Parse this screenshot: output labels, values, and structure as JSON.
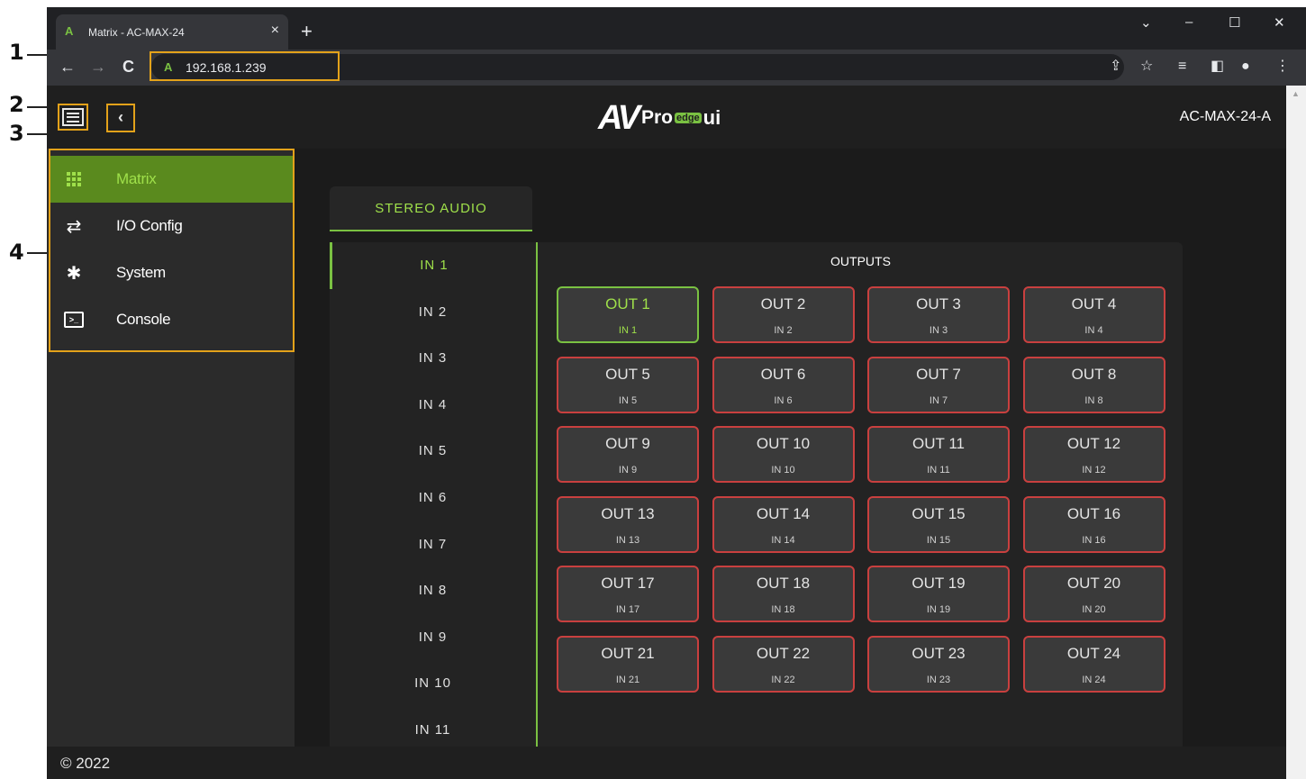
{
  "callouts": [
    "1",
    "2",
    "3",
    "4"
  ],
  "browser": {
    "tab_title": "Matrix - AC-MAX-24",
    "tab_close_glyph": "×",
    "new_tab_glyph": "+",
    "favicon_glyph": "A",
    "url": "192.168.1.239",
    "window_controls": [
      "⌄",
      "–",
      "☐",
      "✕"
    ],
    "nav": {
      "back": "←",
      "forward": "→",
      "reload": "C"
    },
    "toolbar_icons": [
      "⇪",
      "☆",
      "≡",
      "◧",
      "●",
      "⋮"
    ]
  },
  "app": {
    "logo": {
      "av": "AV",
      "pro": "Pro",
      "edge": "edge",
      "ui": "ui"
    },
    "device_name": "AC-MAX-24-A",
    "collapse_glyph": "‹",
    "nav_items": [
      {
        "label": "Matrix",
        "icon": "grid-icon",
        "active": true
      },
      {
        "label": "I/O Config",
        "icon": "swap-arrows-icon",
        "active": false
      },
      {
        "label": "System",
        "icon": "gear-icon",
        "active": false
      },
      {
        "label": "Console",
        "icon": "terminal-icon",
        "active": false
      }
    ],
    "icons": {
      "swap": "⇄",
      "gear": "✱",
      "terminal": ">_"
    },
    "footer": "© 2022"
  },
  "matrix": {
    "tab_label": "STEREO AUDIO",
    "outputs_title": "OUTPUTS",
    "inputs": [
      "IN 1",
      "IN 2",
      "IN 3",
      "IN 4",
      "IN 5",
      "IN 6",
      "IN 7",
      "IN 8",
      "IN 9",
      "IN 10",
      "IN 11"
    ],
    "selected_input": "IN 1",
    "outputs": [
      {
        "name": "OUT 1",
        "source": "IN 1"
      },
      {
        "name": "OUT 2",
        "source": "IN 2"
      },
      {
        "name": "OUT 3",
        "source": "IN 3"
      },
      {
        "name": "OUT 4",
        "source": "IN 4"
      },
      {
        "name": "OUT 5",
        "source": "IN 5"
      },
      {
        "name": "OUT 6",
        "source": "IN 6"
      },
      {
        "name": "OUT 7",
        "source": "IN 7"
      },
      {
        "name": "OUT 8",
        "source": "IN 8"
      },
      {
        "name": "OUT 9",
        "source": "IN 9"
      },
      {
        "name": "OUT 10",
        "source": "IN 10"
      },
      {
        "name": "OUT 11",
        "source": "IN 11"
      },
      {
        "name": "OUT 12",
        "source": "IN 12"
      },
      {
        "name": "OUT 13",
        "source": "IN 13"
      },
      {
        "name": "OUT 14",
        "source": "IN 14"
      },
      {
        "name": "OUT 15",
        "source": "IN 15"
      },
      {
        "name": "OUT 16",
        "source": "IN 16"
      },
      {
        "name": "OUT 17",
        "source": "IN 17"
      },
      {
        "name": "OUT 18",
        "source": "IN 18"
      },
      {
        "name": "OUT 19",
        "source": "IN 19"
      },
      {
        "name": "OUT 20",
        "source": "IN 20"
      },
      {
        "name": "OUT 21",
        "source": "IN 21"
      },
      {
        "name": "OUT 22",
        "source": "IN 22"
      },
      {
        "name": "OUT 23",
        "source": "IN 23"
      },
      {
        "name": "OUT 24",
        "source": "IN 24"
      }
    ]
  },
  "colors": {
    "accent_green": "#7ac142",
    "active_nav_bg": "#5a8a1e",
    "output_border_unrouted": "#c9403f",
    "annotation_highlight": "#e3a21a"
  }
}
